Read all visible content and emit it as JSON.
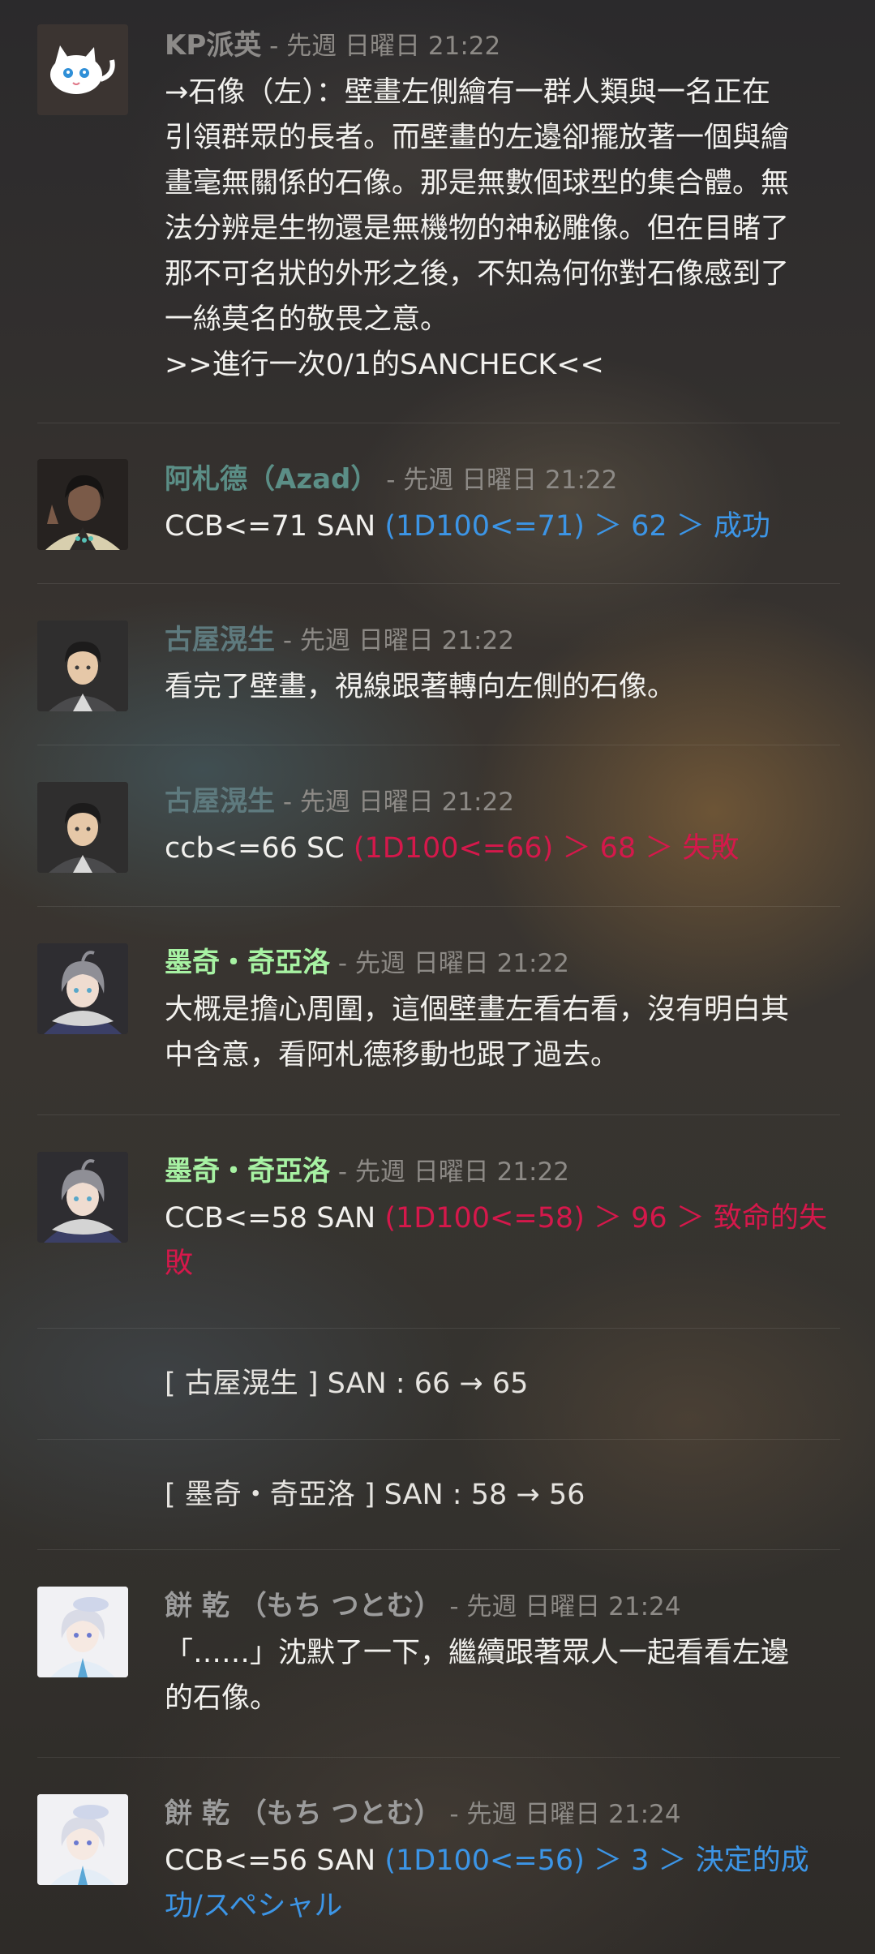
{
  "colors": {
    "name_kp": "#8c8a88",
    "name_azad": "#5b8e86",
    "name_furuya": "#5e7a7e",
    "name_moqi": "#a7f2a3",
    "name_mochi": "#9c9c9c",
    "roll_success": "#3c95e6",
    "roll_fail": "#d5184b"
  },
  "messages": [
    {
      "name": "KP派英",
      "meta": " - 先週 日曜日 21:22",
      "avatar_icon": "white-cat-avatar",
      "lines": [
        "→石像（左）：壁畫左側繪有一群人類與一名正在",
        "引領群眾的長者。而壁畫的左邊卻擺放著一個與繪",
        "畫毫無關係的石像。那是無數個球型的集合體。無",
        "法分辨是生物還是無機物的神秘雕像。但在目睹了",
        "那不可名狀的外形之後，不知為何你對石像感到了",
        "一絲莫名的敬畏之意。",
        ">>進行一次0/1的SANCHECK<<"
      ]
    },
    {
      "name": "阿札德（Azad）",
      "meta": " - 先週 日曜日 21:22",
      "avatar_icon": "dark-haired-man-avatar",
      "text": "CCB<=71 SAN ",
      "roll": "(1D100<=71) ＞ 62 ＞ 成功"
    },
    {
      "name": "古屋滉生",
      "meta": " - 先週 日曜日 21:22",
      "avatar_icon": "young-man-hoodie-avatar",
      "lines": [
        "看完了壁畫，視線跟著轉向左側的石像。"
      ]
    },
    {
      "name": "古屋滉生",
      "meta": " - 先週 日曜日 21:22",
      "avatar_icon": "young-man-hoodie-avatar",
      "text": "ccb<=66 SC ",
      "roll": "(1D100<=66) ＞ 68 ＞ 失敗"
    },
    {
      "name": "墨奇・奇亞洛",
      "meta": " - 先週 日曜日 21:22",
      "avatar_icon": "gray-haired-scarf-avatar",
      "lines": [
        "大概是擔心周圍，這個壁畫左看右看，沒有明白其",
        "中含意，看阿札德移動也跟了過去。"
      ]
    },
    {
      "name": "墨奇・奇亞洛",
      "meta": " - 先週 日曜日 21:22",
      "avatar_icon": "gray-haired-scarf-avatar",
      "text": "CCB<=58 SAN ",
      "roll": "(1D100<=58) ＞ 96 ＞ 致命的失",
      "roll_line2": "敗"
    },
    {
      "system": "[ 古屋滉生 ] SAN : 66 → 65"
    },
    {
      "system": "[ 墨奇・奇亞洛 ] SAN : 58 → 56"
    },
    {
      "name": "餅 乾 （もち つとむ）",
      "meta": " - 先週 日曜日 21:24",
      "avatar_icon": "white-haired-beret-avatar",
      "lines": [
        "「……」沈默了一下，繼續跟著眾人一起看看左邊",
        "的石像。"
      ]
    },
    {
      "name": "餅 乾 （もち つとむ）",
      "meta": " - 先週 日曜日 21:24",
      "avatar_icon": "white-haired-beret-avatar",
      "text": "CCB<=56 SAN ",
      "roll": "(1D100<=56) ＞ 3 ＞ 決定的成",
      "roll_line2": "功/スペシャル"
    }
  ]
}
